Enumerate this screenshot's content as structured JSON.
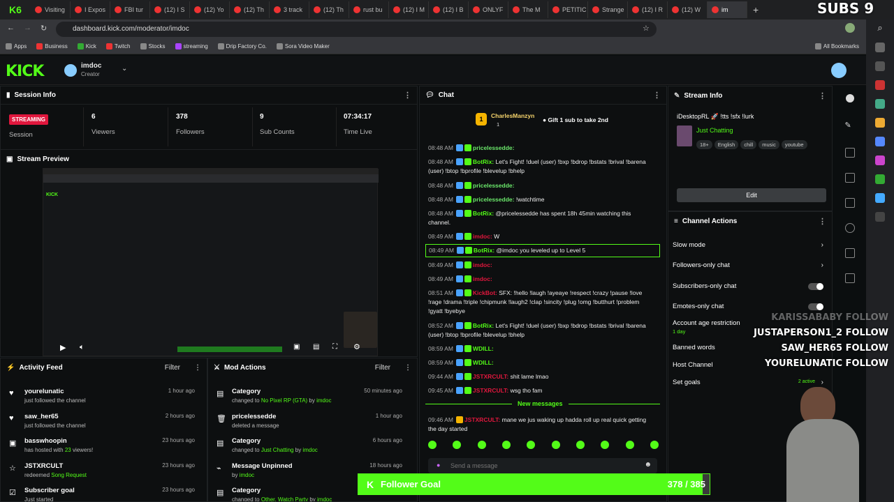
{
  "browser": {
    "tabs": [
      "Visiting",
      "I Expos",
      "FBI tur",
      "(12) I S",
      "(12) Yo",
      "(12) Th",
      "3 track",
      "(12) Th",
      "rust bu",
      "(12) I M",
      "(12) I B",
      "ONLYF",
      "The M",
      "PETITIC",
      "Strange",
      "(12) I R",
      "(12) W",
      "im"
    ],
    "url": "dashboard.kick.com/moderator/imdoc",
    "bookmarks": [
      "Apps",
      "Business",
      "Kick",
      "Twitch",
      "Stocks",
      "streaming",
      "Drip Factory Co.",
      "Sora Video Maker"
    ],
    "all_bookmarks": "All Bookmarks"
  },
  "header": {
    "channel_name": "imdoc",
    "channel_role": "Creator"
  },
  "session_info": {
    "title": "Session Info",
    "status": "STREAMING",
    "status_label": "Session",
    "viewers": "6",
    "viewers_label": "Viewers",
    "followers": "378",
    "followers_label": "Followers",
    "sub_counts": "9",
    "sub_counts_label": "Sub Counts",
    "time_live": "07:34:17",
    "time_live_label": "Time Live"
  },
  "stream_preview": {
    "title": "Stream Preview"
  },
  "chat": {
    "title": "Chat",
    "pinned_user": "CharlesManzyn",
    "pinned_count": "1",
    "gift_text": "Gift 1 sub to take 2nd",
    "messages": [
      {
        "time": "08:48 AM",
        "user": "pricelessedde:",
        "text": "",
        "color": "#6be86b"
      },
      {
        "time": "08:48 AM",
        "user": "BotRix:",
        "text": "Let's Fight! !duel (user) !bxp !bdrop !bstats !brival !barena (user) !btop !bprofile !blevelup !bhelp",
        "color": "#53fc18"
      },
      {
        "time": "08:48 AM",
        "user": "pricelessedde:",
        "text": "",
        "color": "#6be86b"
      },
      {
        "time": "08:48 AM",
        "user": "pricelessedde:",
        "text": "!watchtime",
        "color": "#6be86b"
      },
      {
        "time": "08:48 AM",
        "user": "BotRix:",
        "text": "@pricelessedde has spent 18h 45min watching this channel.",
        "color": "#53fc18"
      },
      {
        "time": "08:49 AM",
        "user": "imdoc:",
        "text": "W",
        "color": "#e0173d"
      },
      {
        "time": "08:49 AM",
        "user": "BotRix:",
        "text": "@imdoc you leveled up to Level 5",
        "color": "#53fc18"
      },
      {
        "time": "08:49 AM",
        "user": "imdoc:",
        "text": "",
        "color": "#e0173d"
      },
      {
        "time": "08:49 AM",
        "user": "imdoc:",
        "text": "",
        "color": "#e0173d"
      },
      {
        "time": "08:51 AM",
        "user": "KickBot:",
        "text": "SFX: !hello !laugh !ayeaye !respect !crazy !pause !love !rage !drama !triple !chipmunk !laugh2 !clap !sincity !plug !omg !butthurt !problem !gyatt !byebye",
        "color": "#e0173d"
      },
      {
        "time": "08:52 AM",
        "user": "BotRix:",
        "text": "Let's Fight! !duel (user) !bxp !bdrop !bstats !brival !barena (user) !btop !bprofile !blevelup !bhelp",
        "color": "#53fc18"
      },
      {
        "time": "08:59 AM",
        "user": "WDILL:",
        "text": "",
        "color": "#53fc18"
      },
      {
        "time": "08:59 AM",
        "user": "WDILL:",
        "text": "",
        "color": "#53fc18"
      },
      {
        "time": "09:44 AM",
        "user": "JSTXRCULT:",
        "text": "shit lame lmao",
        "color": "#e0173d"
      },
      {
        "time": "09:45 AM",
        "user": "JSTXRCULT:",
        "text": "wsg tho fam",
        "color": "#e0173d"
      }
    ],
    "new_messages": "New messages",
    "last_message": {
      "time": "09:46 AM",
      "user": "JSTXRCULT:",
      "text": "mane we jus waking up hadda roll up real quick getting the day started",
      "color": "#e0173d"
    },
    "input_placeholder": "Send a message"
  },
  "stream_info": {
    "title": "Stream Info",
    "stream_title": "iDesktopRL 🚀 !tts !sfx !lurk",
    "category": "Just Chatting",
    "tags": [
      "18+",
      "English",
      "chill",
      "music",
      "youtube"
    ],
    "edit_label": "Edit"
  },
  "channel_actions": {
    "title": "Channel Actions",
    "slow_mode": "Slow mode",
    "followers_only": "Followers-only chat",
    "subscribers_only": "Subscribers-only chat",
    "emotes_only": "Emotes-only chat",
    "account_age": "Account age restriction",
    "account_age_value": "1 day",
    "banned_words": "Banned words",
    "host_channel": "Host Channel",
    "set_goals": "Set goals",
    "goals_active": "2 active"
  },
  "activity_feed": {
    "title": "Activity Feed",
    "filter": "Filter",
    "items": [
      {
        "name": "yourelunatic",
        "sub": "just followed the channel",
        "time": "1 hour ago"
      },
      {
        "name": "saw_her65",
        "sub": "just followed the channel",
        "time": "2 hours ago"
      },
      {
        "name": "basswhoopin",
        "sub_pre": "has hosted with ",
        "sub_hl": "23",
        "sub_post": " viewers!",
        "time": "23 hours ago"
      },
      {
        "name": "JSTXRCULT",
        "sub_pre": "redeemed ",
        "sub_hl": "Song Request",
        "sub_post": "",
        "time": "23 hours ago"
      },
      {
        "name": "Subscriber goal",
        "sub": "Just started",
        "time": "23 hours ago"
      }
    ]
  },
  "mod_actions": {
    "title": "Mod Actions",
    "filter": "Filter",
    "items": [
      {
        "name": "Category",
        "sub_pre": "changed to ",
        "sub_hl": "No Pixel RP (GTA)",
        "sub_mid": " by ",
        "sub_hl2": "imdoc",
        "time": "50 minutes ago"
      },
      {
        "name": "pricelessedde",
        "sub_pre": "deleted a message",
        "sub_hl": "",
        "sub_mid": "",
        "sub_hl2": "",
        "time": "1 hour ago"
      },
      {
        "name": "Category",
        "sub_pre": "changed to ",
        "sub_hl": "Just Chatting",
        "sub_mid": " by ",
        "sub_hl2": "imdoc",
        "time": "6 hours ago"
      },
      {
        "name": "Message Unpinned",
        "sub_pre": "by ",
        "sub_hl": "imdoc",
        "sub_mid": "",
        "sub_hl2": "",
        "time": "18 hours ago"
      },
      {
        "name": "Category",
        "sub_pre": "changed to ",
        "sub_hl": "Other, Watch Party",
        "sub_mid": " by ",
        "sub_hl2": "imdoc",
        "time": "23 hours ago"
      }
    ]
  },
  "overlay": {
    "subs": "SUBS 9",
    "follow_alerts": [
      "KARISSABABY FOLLOW",
      "JUSTAPERSON1_2 FOLLOW",
      "SAW_HER65 FOLLOW",
      "YOURELUNATIC FOLLOW"
    ],
    "goal_label": "Follower Goal",
    "goal_value": "378 / 385",
    "goal_progress": 0.98
  },
  "colors": {
    "kick_green": "#53fc18",
    "live_red": "#e0173d"
  }
}
